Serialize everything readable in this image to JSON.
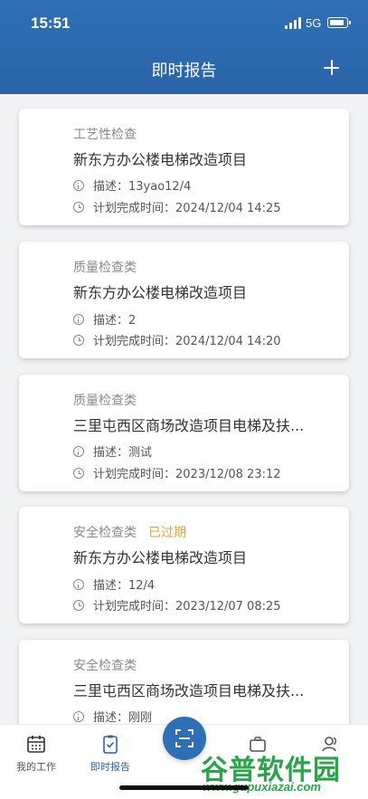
{
  "status_bar": {
    "time": "15:51",
    "network": "5G"
  },
  "header": {
    "title": "即时报告"
  },
  "cards": [
    {
      "category": "工艺性检查",
      "badge": "",
      "title": "新东方办公楼电梯改造项目",
      "description": "描述：13yao12/4",
      "deadline": "计划完成时间：2024/12/04  14:25"
    },
    {
      "category": "质量检查类",
      "badge": "",
      "title": "新东方办公楼电梯改造项目",
      "description": "描述：2",
      "deadline": "计划完成时间：2024/12/04  14:20"
    },
    {
      "category": "质量检查类",
      "badge": "",
      "title": " 三里屯西区商场改造项目电梯及扶...",
      "description": "描述：测试",
      "deadline": "计划完成时间：2023/12/08  23:12"
    },
    {
      "category": "安全检查类",
      "badge": "已过期",
      "title": "新东方办公楼电梯改造项目",
      "description": "描述：12/4",
      "deadline": "计划完成时间：2023/12/07  08:25"
    },
    {
      "category": "安全检查类",
      "badge": "",
      "title": " 三里屯西区商场改造项目电梯及扶...",
      "description": "描述：刚刚",
      "deadline": ""
    }
  ],
  "tabbar": {
    "tabs": [
      {
        "label": "我的工作",
        "icon": "calendar-icon"
      },
      {
        "label": "即时报告",
        "icon": "clipboard-check-icon"
      },
      {
        "label": "",
        "icon": "briefcase-icon"
      },
      {
        "label": "",
        "icon": "contacts-icon"
      }
    ],
    "scan_icon": "scan-icon"
  },
  "watermark": {
    "text": "谷普软件园",
    "url": "www.gupuxiazai.com"
  },
  "colors": {
    "primary": "#2f6fb6",
    "badge": "#e5a43a",
    "background": "#f2f3f5"
  }
}
